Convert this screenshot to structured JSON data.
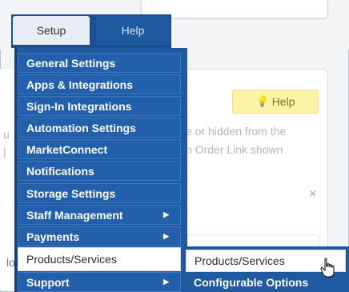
{
  "nav": {
    "tabs": [
      {
        "label": "Setup"
      },
      {
        "label": "Help"
      }
    ]
  },
  "background": {
    "help_button_label": "Help",
    "text_line1": "e or hidden from the",
    "text_line2": "n Order Link shown",
    "left_char1": "u",
    "left_char2": "|",
    "left_char3": "lo",
    "close_symbol": "×"
  },
  "dropdown": {
    "items": [
      {
        "label": "General Settings"
      },
      {
        "label": "Apps & Integrations"
      },
      {
        "label": "Sign-In Integrations"
      },
      {
        "label": "Automation Settings"
      },
      {
        "label": "MarketConnect"
      },
      {
        "label": "Notifications"
      },
      {
        "label": "Storage Settings"
      },
      {
        "label": "Staff Management"
      },
      {
        "label": "Payments"
      },
      {
        "label": "Products/Services"
      },
      {
        "label": "Support"
      }
    ]
  },
  "submenu": {
    "items": [
      {
        "label": "Products/Services"
      },
      {
        "label": "Configurable Options"
      }
    ]
  },
  "colors": {
    "menu_bg": "#1f5aa0",
    "help_button_bg": "#fbf3a6"
  },
  "icons": {
    "caret": "caret-right-icon",
    "bulb": "lightbulb-icon",
    "cursor": "hand-pointer-icon"
  }
}
